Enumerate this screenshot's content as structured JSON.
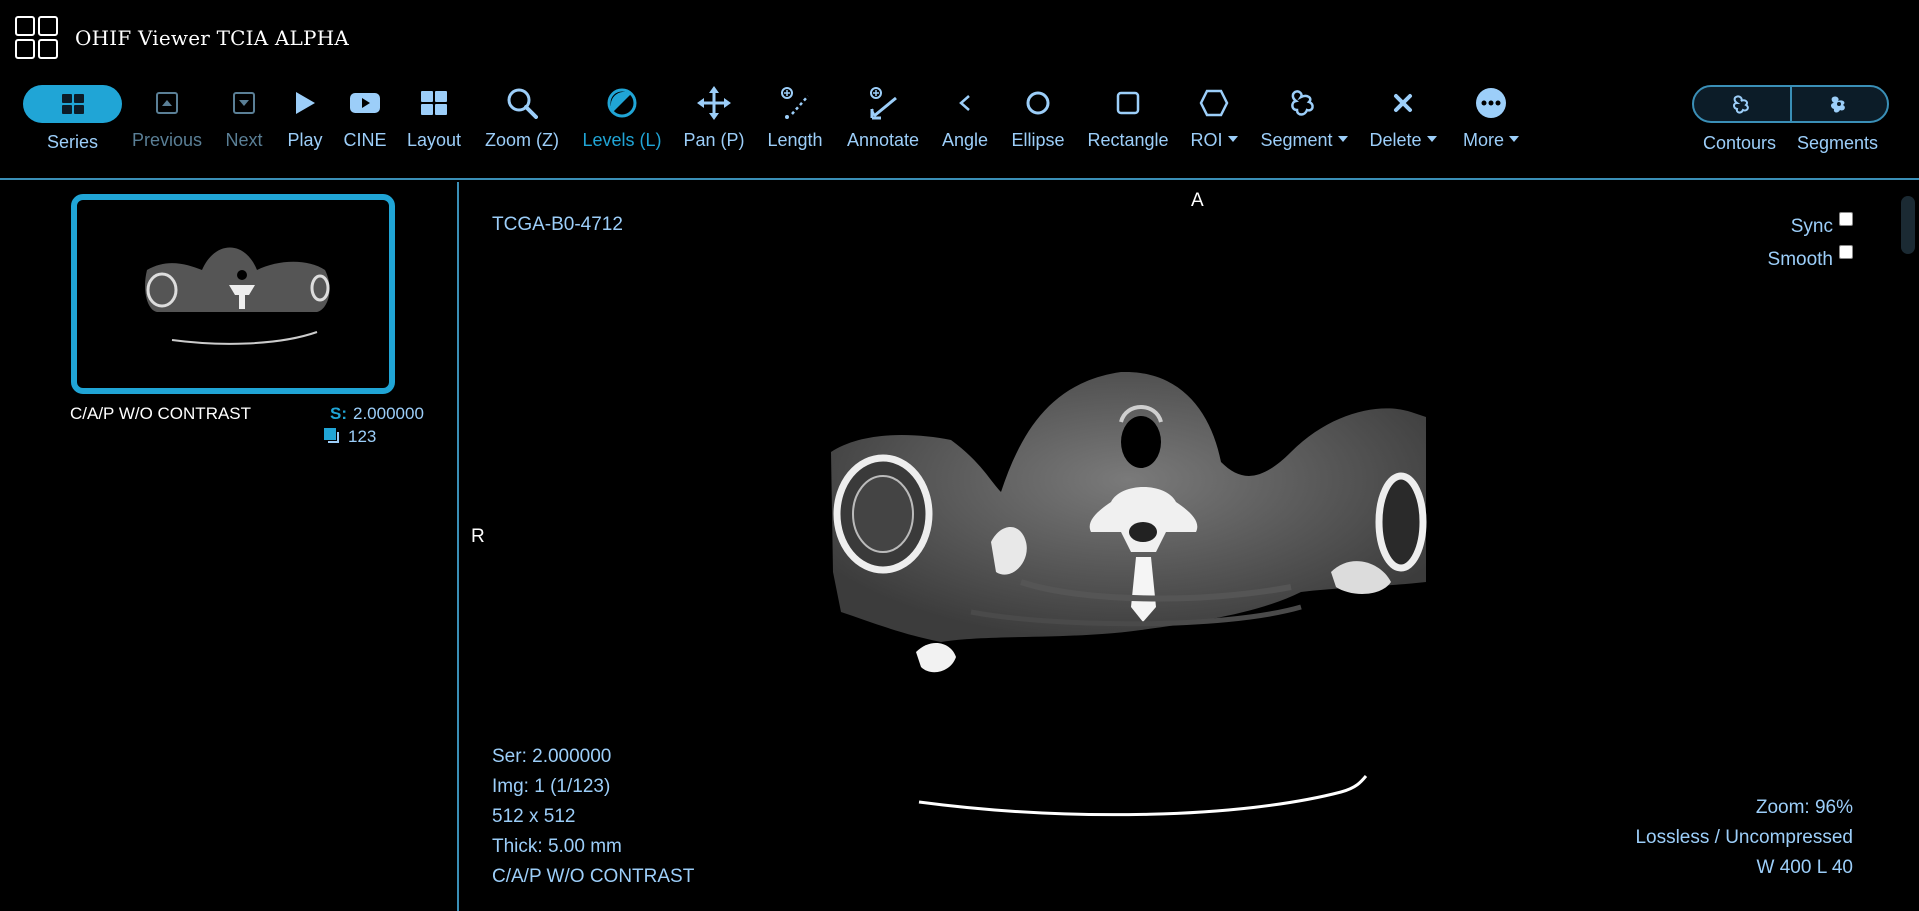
{
  "app": {
    "title": "OHIF Viewer TCIA ALPHA",
    "logo_icon": "grid-logo-icon"
  },
  "toolbar": {
    "series": "Series",
    "previous": "Previous",
    "next": "Next",
    "play": "Play",
    "cine": "CINE",
    "layout": "Layout",
    "zoom": "Zoom (Z)",
    "levels": "Levels (L)",
    "pan": "Pan (P)",
    "length": "Length",
    "annotate": "Annotate",
    "angle": "Angle",
    "ellipse": "Ellipse",
    "rectangle": "Rectangle",
    "roi": "ROI",
    "segment": "Segment",
    "delete": "Delete",
    "more": "More",
    "contours": "Contours",
    "segments": "Segments"
  },
  "series_panel": {
    "description": "C/A/P W/O CONTRAST",
    "s_label": "S:",
    "s_value": "2.000000",
    "count": "123"
  },
  "viewport": {
    "patient_id": "TCGA-B0-4712",
    "orient_top": "A",
    "orient_left": "R",
    "sync": "Sync",
    "smooth": "Smooth",
    "ser": "Ser: 2.000000",
    "img": "Img: 1 (1/123)",
    "dims": "512 x 512",
    "thick": "Thick: 5.00 mm",
    "desc": "C/A/P W/O CONTRAST",
    "zoom": "Zoom: 96%",
    "compression": "Lossless / Uncompressed",
    "wl": "W 400 L 40"
  },
  "colors": {
    "accent": "#20a5d6",
    "text": "#9ccef9",
    "border": "#3a8fb7",
    "background": "#000000"
  }
}
